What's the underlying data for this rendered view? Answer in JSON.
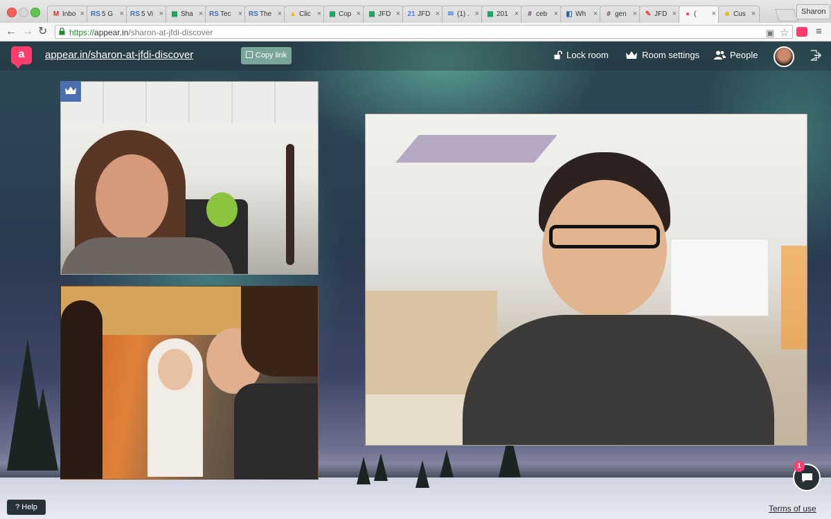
{
  "browser": {
    "profile_name": "Sharon",
    "url_scheme": "https://",
    "url_host": "appear.in",
    "url_path": "/sharon-at-jfdi-discover",
    "tabs": [
      {
        "title": "Inbo",
        "icon": "gmail-icon",
        "icon_char": "M",
        "icon_color": "#d93025"
      },
      {
        "title": "5 G",
        "icon": "rs-icon",
        "icon_char": "RS",
        "icon_color": "#3a6fb5"
      },
      {
        "title": "5 Vi",
        "icon": "rs-icon",
        "icon_char": "RS",
        "icon_color": "#3a6fb5"
      },
      {
        "title": "Sha",
        "icon": "sheets-icon",
        "icon_char": "▦",
        "icon_color": "#0f9d58"
      },
      {
        "title": "Tec",
        "icon": "rs-icon",
        "icon_char": "RS",
        "icon_color": "#3a6fb5"
      },
      {
        "title": "The",
        "icon": "rs-icon",
        "icon_char": "RS",
        "icon_color": "#3a6fb5"
      },
      {
        "title": "Clic",
        "icon": "drive-icon",
        "icon_char": "▲",
        "icon_color": "#f4b400"
      },
      {
        "title": "Cop",
        "icon": "sheets-icon",
        "icon_char": "▦",
        "icon_color": "#0f9d58"
      },
      {
        "title": "JFD",
        "icon": "sheets-icon",
        "icon_char": "▦",
        "icon_color": "#0f9d58"
      },
      {
        "title": "JFD",
        "icon": "calendar-icon",
        "icon_char": "21",
        "icon_color": "#4285f4"
      },
      {
        "title": "(1) .",
        "icon": "message-icon",
        "icon_char": "✉",
        "icon_color": "#4285f4"
      },
      {
        "title": "201",
        "icon": "sheets-icon",
        "icon_char": "▦",
        "icon_color": "#0f9d58"
      },
      {
        "title": "ceb",
        "icon": "slack-icon",
        "icon_char": "#",
        "icon_color": "#5a3a5a"
      },
      {
        "title": "Wh",
        "icon": "wh-icon",
        "icon_char": "◧",
        "icon_color": "#2a5ca8"
      },
      {
        "title": "gen",
        "icon": "slack-icon",
        "icon_char": "#",
        "icon_color": "#5a3a5a"
      },
      {
        "title": "JFD",
        "icon": "pen-icon",
        "icon_char": "✎",
        "icon_color": "#e04040"
      },
      {
        "title": "(",
        "icon": "appear-icon",
        "icon_char": "●",
        "icon_color": "#ff3d6c"
      },
      {
        "title": "Cus",
        "icon": "smiley-icon",
        "icon_char": "☻",
        "icon_color": "#e6b800"
      }
    ]
  },
  "app": {
    "logo_letter": "a",
    "room_link": "appear.in/sharon-at-jfdi-discover",
    "copy_link": "Copy link",
    "lock_room": "Lock room",
    "room_settings": "Room settings",
    "people": "People",
    "help": "? Help",
    "terms": "Terms of use",
    "chat_unread": "1"
  },
  "colors": {
    "brand": "#ff3d6c",
    "copy_button": "#7aa69a",
    "owner_badge": "#4c6fb1"
  }
}
